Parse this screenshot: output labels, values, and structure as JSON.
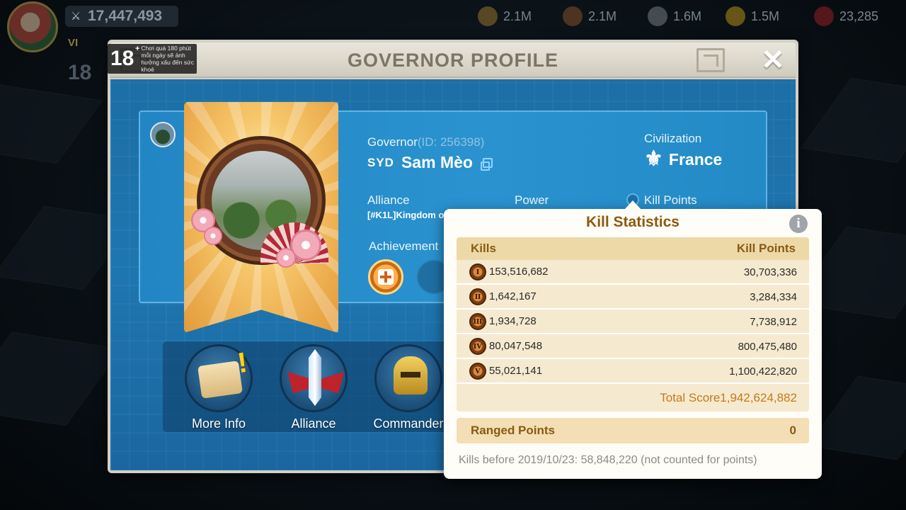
{
  "top_bar": {
    "power": "17,447,493",
    "vip_label": "VI",
    "age_small": "18",
    "resources": [
      {
        "icon": "food-icon",
        "value": "2.1M"
      },
      {
        "icon": "wood-icon",
        "value": "2.1M"
      },
      {
        "icon": "stone-icon",
        "value": "1.6M"
      },
      {
        "icon": "gold-icon",
        "value": "1.5M"
      },
      {
        "icon": "gem-icon",
        "value": "23,285"
      }
    ]
  },
  "age_rating": {
    "age": "18",
    "plus": "+",
    "warning": "Chơi quá 180 phút mỗi ngày sẽ ảnh hưởng xấu đến sức khoẻ"
  },
  "window": {
    "title": "GOVERNOR PROFILE",
    "close_symbol": "✕"
  },
  "governor": {
    "label": "Governor",
    "id_text": "(ID: 256398)",
    "tag": "SYD",
    "name": "Sam Mèo",
    "civilization_label": "Civilization",
    "civilization": "France",
    "alliance_label": "Alliance",
    "alliance": "[#K1L]Kingdom o",
    "power_label": "Power",
    "kill_points_label": "Kill Points",
    "achievement_label": "Achievement"
  },
  "menu_buttons": [
    {
      "label": "More Info",
      "icon": "scroll-icon"
    },
    {
      "label": "Alliance",
      "icon": "sword-emblem-icon"
    },
    {
      "label": "Commander",
      "icon": "helmet-icon"
    }
  ],
  "kill_stats": {
    "title": "Kill Statistics",
    "col_kills": "Kills",
    "col_points": "Kill Points",
    "rows": [
      {
        "tier": "I",
        "kills": "153,516,682",
        "points": "30,703,336"
      },
      {
        "tier": "II",
        "kills": "1,642,167",
        "points": "3,284,334"
      },
      {
        "tier": "III",
        "kills": "1,934,728",
        "points": "7,738,912"
      },
      {
        "tier": "IV",
        "kills": "80,047,548",
        "points": "800,475,480"
      },
      {
        "tier": "V",
        "kills": "55,021,141",
        "points": "1,100,422,820"
      }
    ],
    "total_label": "Total Score",
    "total_value": "1,942,624,882",
    "ranged_label": "Ranged Points",
    "ranged_value": "0",
    "note": "Kills before 2019/10/23: 58,848,220 (not counted for points)"
  },
  "colors": {
    "panel_blue": "#1e76b0",
    "gold_text": "#8a5a10",
    "total_orange": "#c57a16"
  }
}
